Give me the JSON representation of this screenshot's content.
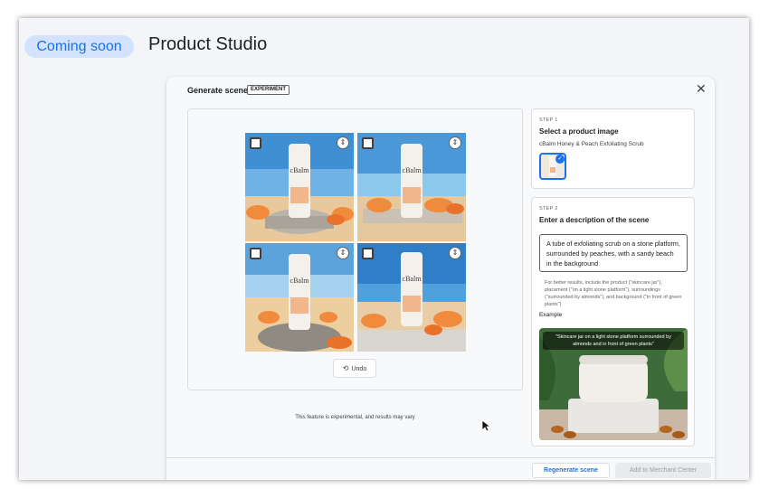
{
  "header": {
    "badge": "Coming soon",
    "title": "Product Studio"
  },
  "dialog": {
    "title": "Generate scene",
    "badge": "EXPERIMENT",
    "close_icon": "close-icon"
  },
  "gallery": {
    "tiles": [
      {
        "product_text": "cBalm"
      },
      {
        "product_text": "cBalm"
      },
      {
        "product_text": "cBalm"
      },
      {
        "product_text": "cBalm"
      }
    ],
    "undo_label": "Undo",
    "undo_icon": "undo-icon",
    "disclaimer": "This feature is experimental, and results may vary"
  },
  "step1": {
    "label": "STEP 1",
    "title": "Select a product image",
    "product_name": "cBalm Honey & Peach Exfoliating Scrub"
  },
  "step2": {
    "label": "STEP 2",
    "title": "Enter a description of the scene",
    "description": "A tube of exfoliating scrub on a stone platform, surrounded by peaches, with a sandy beach in the background",
    "hint": "For better results, include the product (\"skincare jar\"), placement (\"on a light stone platform\"), surroundings (\"surrounded by almonds\"), and background (\"in front of green plants\")",
    "example_label": "Example",
    "example_caption": "\"Skincare jar on a light stone platform surrounded by almonds and in front of green plants\""
  },
  "footer": {
    "regenerate_label": "Regenerate scene",
    "merchant_label": "Add to Merchant Center"
  },
  "colors": {
    "accent": "#1a73e8",
    "pill_bg": "#d3e3fd",
    "sky": "#3f8fd4",
    "sand": "#e9c99c",
    "peach": "#f08a3c"
  }
}
